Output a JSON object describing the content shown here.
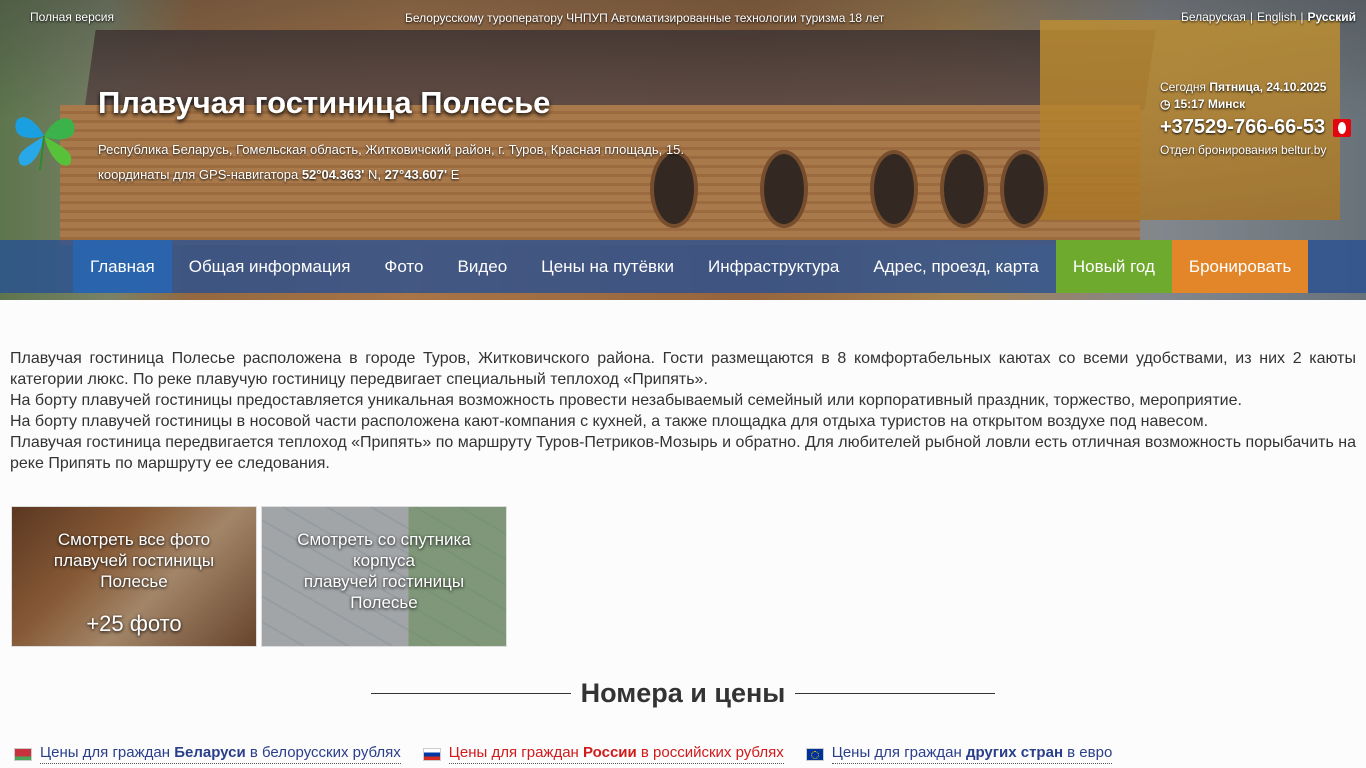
{
  "topbar": {
    "full_version": "Полная версия",
    "slogan": "Белорусскому туроператору ЧНПУП Автоматизированные технологии туризма 18 лет",
    "languages": [
      "Беларуская",
      "English",
      "Русский"
    ],
    "active_language": "Русский"
  },
  "header": {
    "title": "Плавучая гостиница Полесье",
    "address": "Республика Беларусь, Гомельская область, Житковичский район, г. Туров, Красная площадь, 15.",
    "gps_label": "координаты для GPS-навигатора",
    "gps_lat": "52°04.363'",
    "gps_lat_dir": "N,",
    "gps_lon": "27°43.607'",
    "gps_lon_dir": "E"
  },
  "info": {
    "today_label": "Сегодня",
    "date": "Пятница, 24.10.2025",
    "time": "15:17 Минск",
    "phone": "+37529-766-66-53",
    "booking_dept": "Отдел бронирования beltur.by"
  },
  "nav": {
    "items": [
      "Главная",
      "Общая информация",
      "Фото",
      "Видео",
      "Цены на путёвки",
      "Инфраструктура",
      "Адрес, проезд, карта",
      "Новый год",
      "Бронировать"
    ]
  },
  "intro": {
    "p1": "Плавучая гостиница Полесье расположена в городе Туров, Житковичского района. Гости размещаются в 8 комфортабельных каютах со всеми удобствами, из них 2 каюты категории люкс. По реке плавучую гостиницу передвигает специальный теплоход «Припять».",
    "p2": "На борту плавучей гостиницы предоставляется уникальная возможность провести незабываемый семейный или корпоративный праздник, торжество, мероприятие.",
    "p3": "На борту плавучей гостиницы в носовой части расположена кают-компания с кухней, а также площадка для отдыха туристов на открытом воздухе под навесом.",
    "p4": "Плавучая гостиница передвигается теплоход «Припять» по маршруту Туров-Петриков-Мозырь и обратно. Для любителей рыбной ловли есть отличная возможность порыбачить на реке Припять по маршруту ее следования."
  },
  "tiles": {
    "photo_caption_1": "Смотреть все фото",
    "photo_caption_2": "плавучей гостиницы",
    "photo_caption_3": "Полесье",
    "photo_count": "+25 фото",
    "map_caption_1": "Смотреть со спутника",
    "map_caption_2": "корпуса",
    "map_caption_3": "плавучей гостиницы",
    "map_caption_4": "Полесье"
  },
  "rooms": {
    "title": "Номера и цены"
  },
  "prices": {
    "by_pre": "Цены для граждан ",
    "by_country": "Беларуси",
    "by_post": " в белорусских рублях",
    "ru_pre": "Цены для граждан ",
    "ru_country": "России",
    "ru_post": " в российских рублях",
    "eu_pre": "Цены для граждан ",
    "eu_country": "других стран",
    "eu_post": " в евро"
  }
}
